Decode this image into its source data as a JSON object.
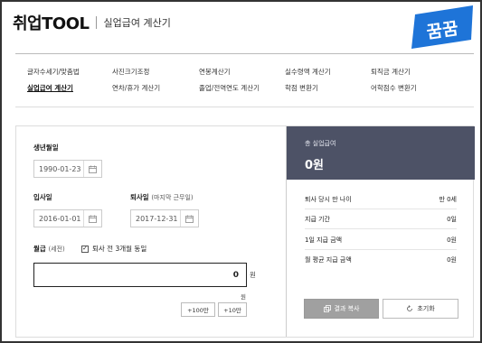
{
  "header": {
    "brand": "취업TOOL",
    "subtitle": "실업급여 계산기"
  },
  "logo": {
    "text": "꿈꿈",
    "color": "#1e74d8"
  },
  "menu": {
    "items": [
      {
        "label": "글자수세기/맞춤법",
        "active": false
      },
      {
        "label": "사진크기조정",
        "active": false
      },
      {
        "label": "연봉계산기",
        "active": false
      },
      {
        "label": "실수령액 계산기",
        "active": false
      },
      {
        "label": "퇴직금 계산기",
        "active": false
      },
      {
        "label": "실업급여 계산기",
        "active": true
      },
      {
        "label": "연차/휴가 계산기",
        "active": false
      },
      {
        "label": "졸업/전역연도 계산기",
        "active": false
      },
      {
        "label": "학점 변환기",
        "active": false
      },
      {
        "label": "어학점수 변환기",
        "active": false
      }
    ]
  },
  "form": {
    "birth": {
      "label": "생년월일",
      "value": "1990-01-23"
    },
    "join": {
      "label": "입사일",
      "value": "2016-01-01"
    },
    "leave": {
      "label": "퇴사일",
      "sub": "(마지막 근무일)",
      "value": "2017-12-31"
    },
    "wage": {
      "label": "월급",
      "sub": "(세전)",
      "same_label": "퇴사 전 3개월 동일",
      "checked": true,
      "value": "0",
      "unit": "원",
      "unit2": "원"
    },
    "buttons": {
      "add_100": "+100만",
      "add_10": "+10만"
    }
  },
  "result": {
    "total_label": "총 실업급여",
    "total_value": "0원",
    "rows": [
      {
        "label": "퇴사 당시 만 나이",
        "value": "만 0세"
      },
      {
        "label": "지급 기간",
        "value": "0일"
      },
      {
        "label": "1일 지급 금액",
        "value": "0원"
      },
      {
        "label": "월 평균 지급 금액",
        "value": "0원"
      }
    ],
    "copy_label": "결과 복사",
    "reset_label": "초기화",
    "header_color": "#4d5266"
  }
}
